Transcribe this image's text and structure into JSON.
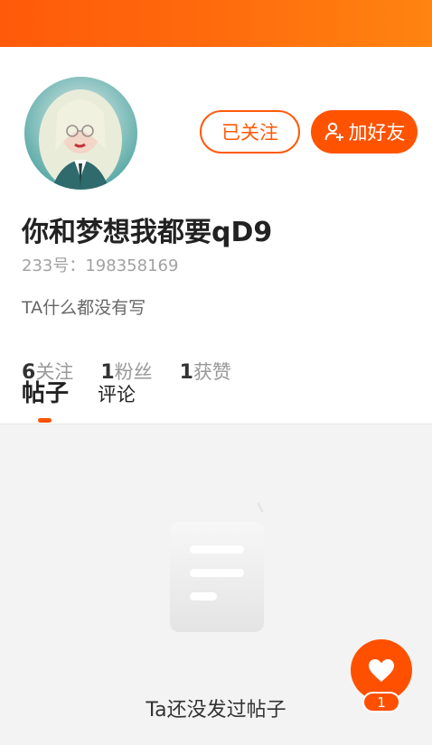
{
  "colors": {
    "accent": "#ff5300",
    "header_gradient_start": "#ff5a0a",
    "header_gradient_end": "#ff8410",
    "background": "#f3f3f3"
  },
  "header": {
    "avatar_icon": "user-avatar-image"
  },
  "actions": {
    "followed_label": "已关注",
    "add_friend_label": "加好友",
    "add_friend_icon": "person-add-icon"
  },
  "profile": {
    "nickname": "你和梦想我都要qD9",
    "id_prefix": "233号：",
    "id_value": "198358169",
    "bio": "TA什么都没有写"
  },
  "stats": [
    {
      "value": "6",
      "label": "关注"
    },
    {
      "value": "1",
      "label": "粉丝"
    },
    {
      "value": "1",
      "label": "获赞"
    }
  ],
  "tabs": [
    {
      "label": "帖子",
      "active": true
    },
    {
      "label": "评论",
      "active": false
    }
  ],
  "empty_state": {
    "icon": "document-icon",
    "text": "Ta还没发过帖子"
  },
  "like_fab": {
    "icon": "heart-icon",
    "count": "1"
  }
}
